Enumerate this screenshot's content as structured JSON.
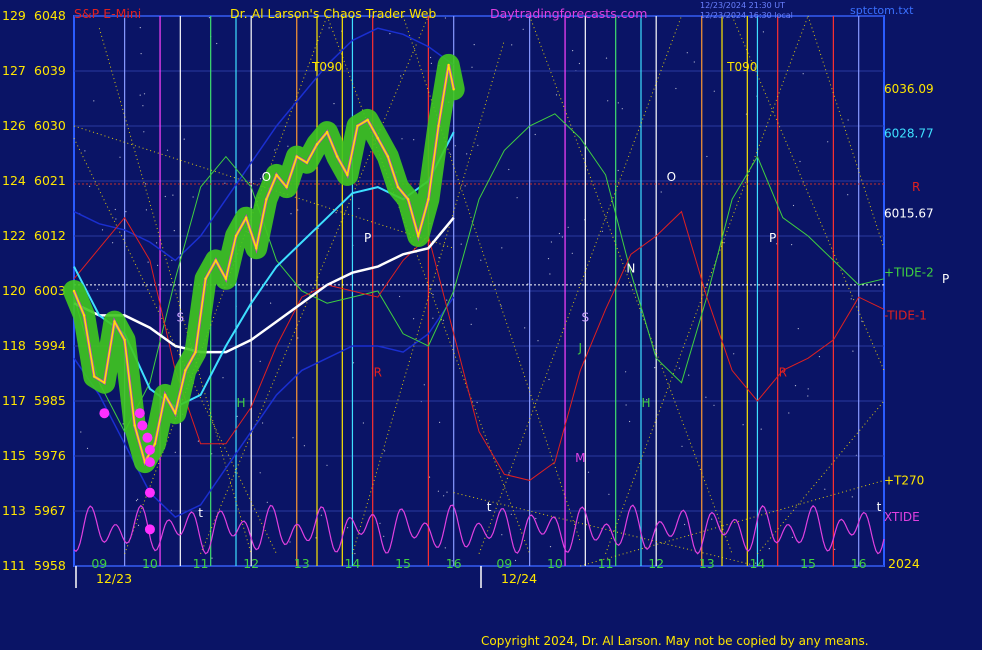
{
  "header": {
    "instrument": "S&P E-Mini",
    "author": "Dr. Al Larson's Chaos Trader Web",
    "site": "Daytradingforecasts.com",
    "stamp1": "12/23/2024 21:30 UT",
    "stamp2": "12/23/2024 16:30 local",
    "corner": "sptctom.txt"
  },
  "footer": "Copyright 2024, Dr. Al Larson. May not be copied by any means.",
  "colors": {
    "background": "#0a1466",
    "plot_border": "#2b5cff",
    "price": "#ffe600",
    "price_glow": "#3fc81f",
    "cyan_ma": "#3ee0ff",
    "white_ma": "#ffffff",
    "tide2": "#3fd040",
    "tide1": "#e02020",
    "xtide": "#e040e0",
    "band": "#1a2fd0",
    "ref_line": "#ffffff",
    "r_line": "#c03030"
  },
  "chart_data": {
    "type": "line",
    "ylim": [
      5958,
      6048
    ],
    "y_ticks": [
      {
        "index": "129",
        "price": "6048",
        "value": 6048
      },
      {
        "index": "127",
        "price": "6039",
        "value": 6039
      },
      {
        "index": "126",
        "price": "6030",
        "value": 6030
      },
      {
        "index": "124",
        "price": "6021",
        "value": 6021
      },
      {
        "index": "122",
        "price": "6012",
        "value": 6012
      },
      {
        "index": "120",
        "price": "6003",
        "value": 6003
      },
      {
        "index": "118",
        "price": "5994",
        "value": 5994
      },
      {
        "index": "117",
        "price": "5985",
        "value": 5985
      },
      {
        "index": "115",
        "price": "5976",
        "value": 5976
      },
      {
        "index": "113",
        "price": "5967",
        "value": 5967
      },
      {
        "index": "111",
        "price": "5958",
        "value": 5958
      }
    ],
    "xlim": [
      8.5,
      24.5
    ],
    "x_ticks": [
      {
        "label": "09",
        "t": 9
      },
      {
        "label": "10",
        "t": 10
      },
      {
        "label": "11",
        "t": 11
      },
      {
        "label": "12",
        "t": 12
      },
      {
        "label": "13",
        "t": 13
      },
      {
        "label": "14",
        "t": 14
      },
      {
        "label": "15",
        "t": 15
      },
      {
        "label": "16",
        "t": 16
      },
      {
        "label": "09",
        "t": 17
      },
      {
        "label": "10",
        "t": 18
      },
      {
        "label": "11",
        "t": 19
      },
      {
        "label": "12",
        "t": 20
      },
      {
        "label": "13",
        "t": 21
      },
      {
        "label": "14",
        "t": 22
      },
      {
        "label": "15",
        "t": 23
      },
      {
        "label": "16",
        "t": 24
      }
    ],
    "dates": [
      {
        "label": "12/23",
        "t": 8.5
      },
      {
        "label": "12/24",
        "t": 16.5
      }
    ],
    "year_label": "2024",
    "right_labels": [
      {
        "text": "6036.09",
        "value": 6036.09,
        "color": "#ffe600"
      },
      {
        "text": "6028.77",
        "value": 6028.77,
        "color": "#3ee0ff"
      },
      {
        "text": "R",
        "value": 6020,
        "color": "#e02020"
      },
      {
        "text": "6015.67",
        "value": 6015.67,
        "color": "#ffffff"
      },
      {
        "text": "+TIDE-2",
        "value": 6006,
        "color": "#3fd040"
      },
      {
        "text": "P",
        "value": 6005,
        "color": "#ffffff"
      },
      {
        "text": "-TIDE-1",
        "value": 5999,
        "color": "#e02020"
      },
      {
        "text": "+T270",
        "value": 5972,
        "color": "#ffe600"
      },
      {
        "text": "XTIDE",
        "value": 5966,
        "color": "#e040e0"
      }
    ],
    "reference_levels": [
      {
        "name": "R",
        "value": 6020.5
      },
      {
        "name": "P",
        "value": 6004
      }
    ],
    "markers": [
      {
        "text": "T090",
        "t": 13.5,
        "value": 6039,
        "color": "#ffe600"
      },
      {
        "text": "T090",
        "t": 21.7,
        "value": 6039,
        "color": "#ffe600"
      },
      {
        "text": "O",
        "t": 12.3,
        "value": 6021,
        "color": "#ffffff"
      },
      {
        "text": "O",
        "t": 20.3,
        "value": 6021,
        "color": "#ffffff"
      },
      {
        "text": "P",
        "t": 14.3,
        "value": 6011,
        "color": "#ffffff"
      },
      {
        "text": "P",
        "t": 22.3,
        "value": 6011,
        "color": "#ffffff"
      },
      {
        "text": "S",
        "t": 10.6,
        "value": 5998,
        "color": "#c8a0ff"
      },
      {
        "text": "S",
        "t": 18.6,
        "value": 5998,
        "color": "#c8a0ff"
      },
      {
        "text": "N",
        "t": 19.5,
        "value": 6006,
        "color": "#ffffff"
      },
      {
        "text": "H",
        "t": 11.8,
        "value": 5984,
        "color": "#3fd040"
      },
      {
        "text": "H",
        "t": 19.8,
        "value": 5984,
        "color": "#3fd040"
      },
      {
        "text": "R",
        "t": 14.5,
        "value": 5989,
        "color": "#e02020"
      },
      {
        "text": "R",
        "t": 22.5,
        "value": 5989,
        "color": "#e02020"
      },
      {
        "text": "J",
        "t": 18.5,
        "value": 5993,
        "color": "#3fd040"
      },
      {
        "text": "M",
        "t": 18.5,
        "value": 5975,
        "color": "#e040e0"
      },
      {
        "text": "t",
        "t": 11.0,
        "value": 5966,
        "color": "#ffffff"
      },
      {
        "text": "t",
        "t": 16.7,
        "value": 5967,
        "color": "#ffffff"
      },
      {
        "text": "t",
        "t": 24.4,
        "value": 5967,
        "color": "#ffffff"
      }
    ],
    "vlines": [
      {
        "t": 9.5,
        "color": "#8899ff"
      },
      {
        "t": 10.2,
        "color": "#ff40ff"
      },
      {
        "t": 10.6,
        "color": "#ffffff"
      },
      {
        "t": 11.2,
        "color": "#3fe070"
      },
      {
        "t": 11.7,
        "color": "#3ee0ff"
      },
      {
        "t": 12.0,
        "color": "#ffffff"
      },
      {
        "t": 12.9,
        "color": "#ff9933"
      },
      {
        "t": 13.3,
        "color": "#ffe600"
      },
      {
        "t": 13.8,
        "color": "#ffe600"
      },
      {
        "t": 14.0,
        "color": "#3ee0ff"
      },
      {
        "t": 14.4,
        "color": "#ff3030"
      },
      {
        "t": 15.5,
        "color": "#ff3030"
      },
      {
        "t": 16.0,
        "color": "#8899ff"
      },
      {
        "t": 17.5,
        "color": "#8899ff"
      },
      {
        "t": 18.2,
        "color": "#ff40ff"
      },
      {
        "t": 18.6,
        "color": "#ffffff"
      },
      {
        "t": 19.2,
        "color": "#3fe070"
      },
      {
        "t": 19.7,
        "color": "#3ee0ff"
      },
      {
        "t": 20.0,
        "color": "#ffffff"
      },
      {
        "t": 20.9,
        "color": "#ff9933"
      },
      {
        "t": 21.3,
        "color": "#ffe600"
      },
      {
        "t": 21.8,
        "color": "#ffe600"
      },
      {
        "t": 22.0,
        "color": "#3ee0ff"
      },
      {
        "t": 22.4,
        "color": "#ff3030"
      },
      {
        "t": 23.5,
        "color": "#ff3030"
      },
      {
        "t": 24.0,
        "color": "#8899ff"
      }
    ],
    "series": [
      {
        "key": "price",
        "x": [
          8.5,
          8.7,
          8.9,
          9.1,
          9.3,
          9.5,
          9.7,
          9.9,
          10.1,
          10.3,
          10.5,
          10.7,
          10.9,
          11.1,
          11.3,
          11.5,
          11.7,
          11.9,
          12.1,
          12.3,
          12.5,
          12.7,
          12.9,
          13.1,
          13.3,
          13.5,
          13.7,
          13.9,
          14.1,
          14.3,
          14.5,
          14.7,
          14.9,
          15.1,
          15.3,
          15.5,
          15.7,
          15.9,
          16.0
        ],
        "values": [
          6003,
          5999,
          5989,
          5988,
          5998,
          5995,
          5981,
          5975,
          5978,
          5986,
          5983,
          5990,
          5993,
          6005,
          6008,
          6005,
          6012,
          6015,
          6010,
          6018,
          6022,
          6020,
          6025,
          6024,
          6027,
          6029,
          6025,
          6022,
          6030,
          6031,
          6028,
          6025,
          6020,
          6018,
          6012,
          6018,
          6030,
          6040,
          6036
        ]
      },
      {
        "key": "cyan_ma",
        "x": [
          8.5,
          9.0,
          9.5,
          10.0,
          10.5,
          11.0,
          11.5,
          12.0,
          12.5,
          13.0,
          13.5,
          14.0,
          14.5,
          15.0,
          15.5,
          16.0
        ],
        "values": [
          6007,
          5999,
          5996,
          5987,
          5984,
          5986,
          5994,
          6001,
          6007,
          6011,
          6015,
          6019,
          6020,
          6018,
          6021,
          6029
        ]
      },
      {
        "key": "white_ma",
        "x": [
          8.5,
          9.0,
          9.5,
          10.0,
          10.5,
          11.0,
          11.5,
          12.0,
          12.5,
          13.0,
          13.5,
          14.0,
          14.5,
          15.0,
          15.5,
          16.0
        ],
        "values": [
          6001,
          5999,
          5999,
          5997,
          5994,
          5993,
          5993,
          5995,
          5998,
          6001,
          6004,
          6006,
          6007,
          6009,
          6010,
          6015
        ]
      },
      {
        "key": "tide2",
        "x": [
          8.5,
          9.0,
          9.5,
          10.0,
          10.5,
          11.0,
          11.5,
          12.0,
          12.5,
          13.0,
          13.5,
          14.0,
          14.5,
          15.0,
          15.5,
          16.0,
          16.5,
          17.0,
          17.5,
          18.0,
          18.5,
          19.0,
          19.5,
          20.0,
          20.5,
          21.0,
          21.5,
          22.0,
          22.5,
          23.0,
          23.5,
          24.0,
          24.5
        ],
        "values": [
          6002,
          5988,
          5980,
          5988,
          6005,
          6020,
          6025,
          6020,
          6008,
          6003,
          6001,
          6002,
          6003,
          5996,
          5994,
          6003,
          6018,
          6026,
          6030,
          6032,
          6028,
          6022,
          6006,
          5992,
          5988,
          6002,
          6018,
          6025,
          6015,
          6012,
          6008,
          6004,
          6005
        ]
      },
      {
        "key": "tide1",
        "x": [
          8.5,
          9.0,
          9.5,
          10.0,
          10.5,
          11.0,
          11.5,
          12.0,
          12.5,
          13.0,
          13.5,
          14.0,
          14.5,
          15.0,
          15.5,
          16.0,
          16.5,
          17.0,
          17.5,
          18.0,
          18.5,
          19.0,
          19.5,
          20.0,
          20.5,
          21.0,
          21.5,
          22.0,
          22.5,
          23.0,
          23.5,
          24.0,
          24.5
        ],
        "values": [
          6005,
          6010,
          6015,
          6008,
          5990,
          5978,
          5978,
          5984,
          5994,
          6002,
          6004,
          6003,
          6002,
          6008,
          6012,
          5996,
          5980,
          5973,
          5972,
          5975,
          5990,
          6000,
          6009,
          6012,
          6016,
          6002,
          5990,
          5985,
          5990,
          5992,
          5995,
          6002,
          6000
        ]
      },
      {
        "key": "band_upper",
        "x": [
          8.5,
          9.0,
          9.5,
          10.0,
          10.5,
          11.0,
          11.5,
          12.0,
          12.5,
          13.0,
          13.5,
          14.0,
          14.5,
          15.0,
          15.5,
          16.0
        ],
        "values": [
          6016,
          6014,
          6013,
          6011,
          6008,
          6012,
          6018,
          6024,
          6030,
          6035,
          6040,
          6044,
          6046,
          6045,
          6043,
          6040
        ]
      },
      {
        "key": "band_lower",
        "x": [
          8.5,
          9.0,
          9.5,
          10.0,
          10.5,
          11.0,
          11.5,
          12.0,
          12.5,
          13.0,
          13.5,
          14.0,
          14.5,
          15.0,
          15.5,
          16.0
        ],
        "values": [
          5992,
          5986,
          5978,
          5970,
          5966,
          5968,
          5974,
          5980,
          5986,
          5990,
          5992,
          5994,
          5994,
          5993,
          5996,
          6002
        ]
      }
    ],
    "xtide": {
      "baseline": 5964,
      "amplitude": 4
    },
    "low_dots": [
      {
        "t": 9.1,
        "value": 5983
      },
      {
        "t": 9.8,
        "value": 5983
      },
      {
        "t": 9.85,
        "value": 5981
      },
      {
        "t": 9.95,
        "value": 5979
      },
      {
        "t": 10.0,
        "value": 5977
      },
      {
        "t": 10.0,
        "value": 5975
      },
      {
        "t": 10.0,
        "value": 5970
      },
      {
        "t": 10.0,
        "value": 5964
      }
    ]
  }
}
